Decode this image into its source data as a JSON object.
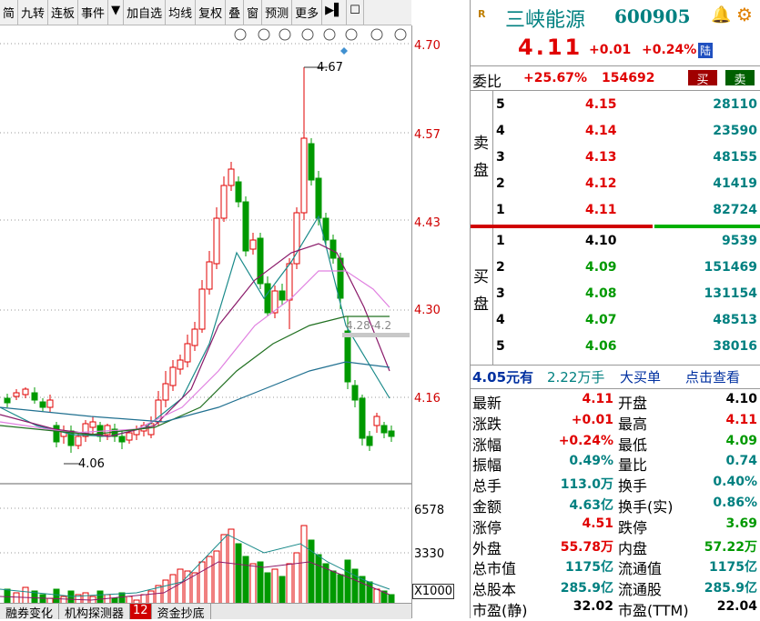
{
  "toolbar": {
    "items": [
      "简",
      "九转",
      "连板",
      "事件",
      "▼",
      "加自选",
      "均线",
      "复权",
      "叠",
      "窗",
      "预测",
      "更多",
      "▶▌",
      "☐"
    ]
  },
  "chart": {
    "price_labels": [
      "4.70",
      "4.57",
      "4.43",
      "4.30",
      "4.16"
    ],
    "high_marker": "4.67",
    "low_marker": "4.06",
    "ma_label": "4.28-4.2",
    "volume_labels": [
      "6578",
      "3330"
    ],
    "volume_unit": "X1000",
    "tools": [
      "eye-icon",
      "hand-icon",
      "play-icon",
      "undo-icon",
      "scissors-icon",
      "lock-icon",
      "minus-circle-icon",
      "plus-circle-icon",
      "minus-circle-icon"
    ]
  },
  "bottom_tabs": [
    "融券变化",
    "机构探测器",
    "12",
    "资金抄底"
  ],
  "stock": {
    "name": "三峡能源",
    "code": "600905",
    "price": "4.11",
    "change": "+0.01",
    "pct": "+0.24%",
    "tag": "陆"
  },
  "weibi": {
    "label": "委比",
    "pct": "+25.67%",
    "diff": "154692",
    "buy": "买",
    "sell": "卖"
  },
  "sell_label": [
    "卖",
    "盘"
  ],
  "buy_label": [
    "买",
    "盘"
  ],
  "asks": [
    {
      "lvl": "5",
      "price": "4.15",
      "vol": "28110"
    },
    {
      "lvl": "4",
      "price": "4.14",
      "vol": "23590"
    },
    {
      "lvl": "3",
      "price": "4.13",
      "vol": "48155"
    },
    {
      "lvl": "2",
      "price": "4.12",
      "vol": "41419"
    },
    {
      "lvl": "1",
      "price": "4.11",
      "vol": "82724"
    }
  ],
  "bids": [
    {
      "lvl": "1",
      "price": "4.10",
      "vol": "9539"
    },
    {
      "lvl": "2",
      "price": "4.09",
      "vol": "151469"
    },
    {
      "lvl": "3",
      "price": "4.08",
      "vol": "131154"
    },
    {
      "lvl": "4",
      "price": "4.07",
      "vol": "48513"
    },
    {
      "lvl": "5",
      "price": "4.06",
      "vol": "38016"
    }
  ],
  "bigorder": {
    "price": "4.05元有",
    "amount": "2.22万手",
    "label": "大买单",
    "link": "点击查看"
  },
  "stats": [
    {
      "l1": "最新",
      "v1": "4.11",
      "c1": "red",
      "l2": "开盘",
      "v2": "4.10",
      "c2": "blk"
    },
    {
      "l1": "涨跌",
      "v1": "+0.01",
      "c1": "red",
      "l2": "最高",
      "v2": "4.11",
      "c2": "red"
    },
    {
      "l1": "涨幅",
      "v1": "+0.24%",
      "c1": "red",
      "l2": "最低",
      "v2": "4.09",
      "c2": "grn"
    },
    {
      "l1": "振幅",
      "v1": "0.49%",
      "c1": "teal",
      "l2": "量比",
      "v2": "0.74",
      "c2": "teal"
    },
    {
      "l1": "总手",
      "v1": "113.0万",
      "c1": "teal",
      "l2": "换手",
      "v2": "0.40%",
      "c2": "teal"
    },
    {
      "l1": "金额",
      "v1": "4.63亿",
      "c1": "teal",
      "l2": "换手(实)",
      "v2": "0.86%",
      "c2": "teal"
    },
    {
      "l1": "涨停",
      "v1": "4.51",
      "c1": "red",
      "l2": "跌停",
      "v2": "3.69",
      "c2": "grn"
    },
    {
      "l1": "外盘",
      "v1": "55.78万",
      "c1": "red",
      "l2": "内盘",
      "v2": "57.22万",
      "c2": "grn"
    },
    {
      "l1": "总市值",
      "v1": "1175亿",
      "c1": "teal",
      "l2": "流通值",
      "v2": "1175亿",
      "c2": "teal"
    },
    {
      "l1": "总股本",
      "v1": "285.9亿",
      "c1": "teal",
      "l2": "流通股",
      "v2": "285.9亿",
      "c2": "teal"
    },
    {
      "l1": "市盈(静)",
      "v1": "32.02",
      "c1": "blk",
      "l2": "市盈(TTM)",
      "v2": "22.04",
      "c2": "blk"
    }
  ],
  "colors": {
    "up": "#e00000",
    "down": "#009900",
    "bg": "#ffffff"
  }
}
